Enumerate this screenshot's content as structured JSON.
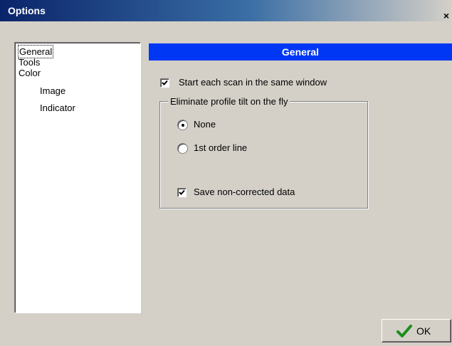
{
  "window": {
    "title": "Options",
    "close_glyph": "×"
  },
  "tree": {
    "items": [
      {
        "label": "General",
        "level": 0,
        "selected": true
      },
      {
        "label": "Tools",
        "level": 0,
        "selected": false
      },
      {
        "label": "Color",
        "level": 0,
        "selected": false
      },
      {
        "label": "Image",
        "level": 1,
        "selected": false
      },
      {
        "label": "Indicator",
        "level": 1,
        "selected": false
      }
    ]
  },
  "panel": {
    "header": "General",
    "header_color": "#0037f5",
    "start_scan_same_window": {
      "label": "Start each scan in the same window",
      "checked": true
    },
    "tilt_group": {
      "title": "Eliminate profile tilt on the fly",
      "options": [
        {
          "label": "None",
          "selected": true
        },
        {
          "label": "1st order line",
          "selected": false
        }
      ],
      "save_noncorrected": {
        "label": "Save non-corrected data",
        "checked": true
      }
    }
  },
  "buttons": {
    "ok": {
      "label": "OK",
      "icon": "checkmark-icon",
      "icon_color": "#1a8f1a"
    }
  }
}
